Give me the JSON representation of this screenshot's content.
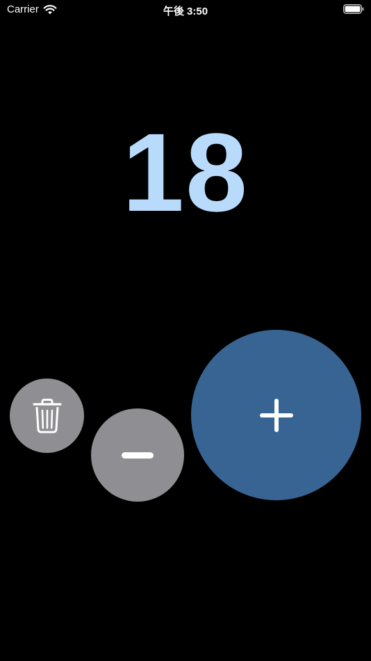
{
  "status_bar": {
    "carrier": "Carrier",
    "time": "午後 3:50",
    "icons": [
      "wifi-icon",
      "battery-icon"
    ]
  },
  "counter": {
    "value": "18",
    "color": "#b9dbfb"
  },
  "controls": {
    "delete_icon": "trash-icon",
    "decrement_icon": "minus-icon",
    "increment_icon": "plus-icon",
    "delete_color": "#8e8e93",
    "decrement_color": "#8e8e93",
    "increment_color": "#376493"
  }
}
